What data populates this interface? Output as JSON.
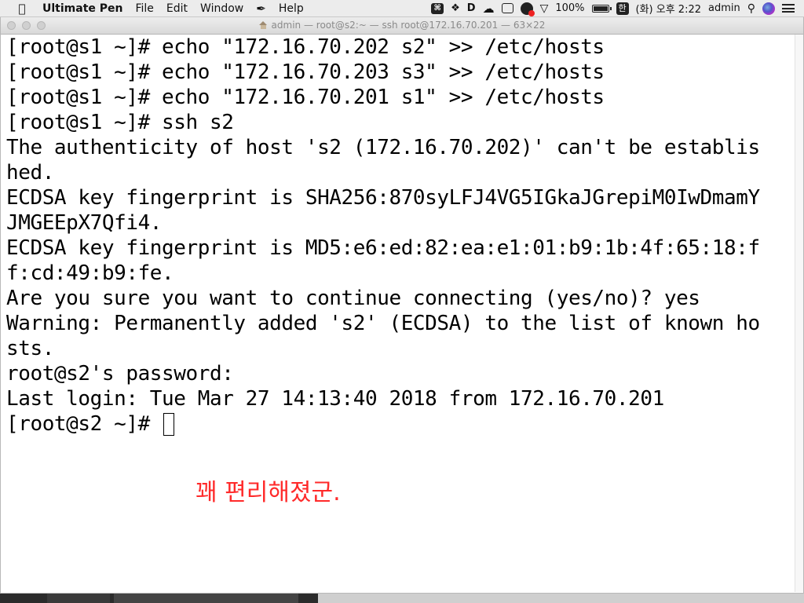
{
  "menubar": {
    "app_name": "Ultimate Pen",
    "menus": [
      "File",
      "Edit",
      "Window",
      "Help"
    ],
    "battery_percent": "100%",
    "ime_label": "한",
    "clock": "(화) 오후 2:22",
    "user": "admin",
    "status_icons": [
      "command-key-icon",
      "dropbox-icon",
      "d-icon",
      "cloud-icon",
      "window-icon",
      "recording-icon",
      "wifi-icon",
      "battery-icon"
    ],
    "battery_level": 1.0
  },
  "window": {
    "title": "admin — root@s2:~ — ssh root@172.16.70.201 — 63×22"
  },
  "terminal": {
    "lines": [
      "[root@s1 ~]# echo \"172.16.70.202 s2\" >> /etc/hosts",
      "[root@s1 ~]# echo \"172.16.70.203 s3\" >> /etc/hosts",
      "[root@s1 ~]# echo \"172.16.70.201 s1\" >> /etc/hosts",
      "[root@s1 ~]# ssh s2",
      "The authenticity of host 's2 (172.16.70.202)' can't be establis",
      "hed.",
      "ECDSA key fingerprint is SHA256:870syLFJ4VG5IGkaJGrepiM0IwDmamY",
      "JMGEEpX7Qfi4.",
      "ECDSA key fingerprint is MD5:e6:ed:82:ea:e1:01:b9:1b:4f:65:18:f",
      "f:cd:49:b9:fe.",
      "Are you sure you want to continue connecting (yes/no)? yes",
      "Warning: Permanently added 's2' (ECDSA) to the list of known ho",
      "sts.",
      "root@s2's password:",
      "Last login: Tue Mar 27 14:13:40 2018 from 172.16.70.201"
    ],
    "prompt": "[root@s2 ~]# "
  },
  "annotation": {
    "text": "꽤 편리해졌군.",
    "color": "#ff2a2a"
  }
}
